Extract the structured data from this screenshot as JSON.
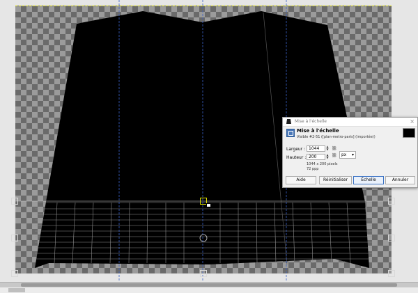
{
  "dialog": {
    "window_title": "Mise à l'échelle",
    "header_title": "Mise à l'échelle",
    "header_subtitle": "Visible #2-51 ([plan-metro-paris] (importée))",
    "width_label": "Largeur :",
    "width_value": "1044",
    "height_label": "Hauteur :",
    "height_value": "200",
    "unit": "px",
    "size_info": "1044 x 200 pixels",
    "resolution_info": "72 ppp",
    "buttons": {
      "help": "Aide",
      "reset": "Réinitialiser",
      "scale": "Échelle",
      "cancel": "Annuler"
    },
    "close_glyph": "×",
    "chain_glyph": "⛓",
    "spin_up": "▲",
    "spin_down": "▼",
    "unit_arrow": "▾"
  },
  "icons": {
    "title_icon": "layer-scale-icon",
    "tool_icon": "scale-tool-icon",
    "chain": "chain-link-icon",
    "close": "close-icon"
  },
  "colors": {
    "guide": "#3a62c9",
    "selection": "#e0e000",
    "accent": "#3b73c4"
  }
}
